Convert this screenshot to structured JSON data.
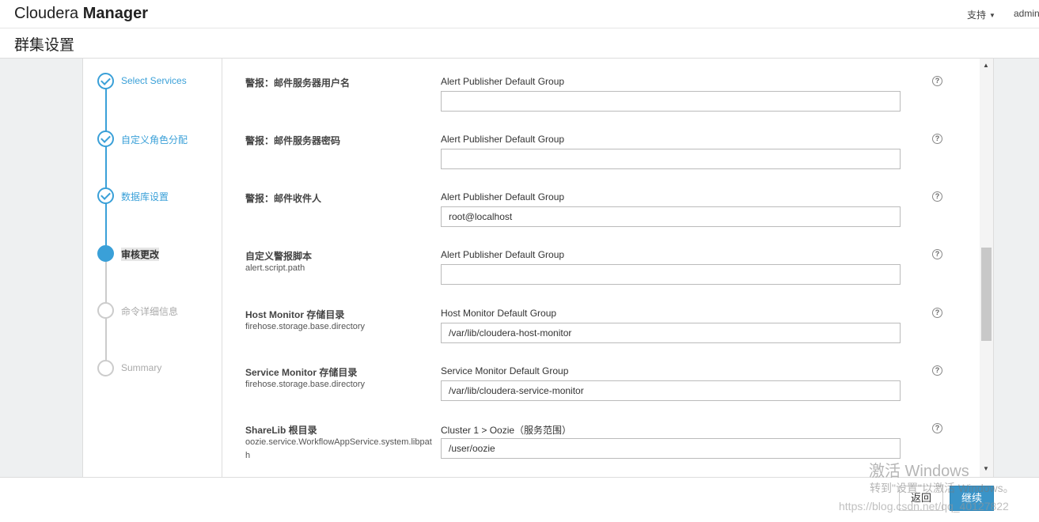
{
  "header": {
    "brand_light": "Cloudera",
    "brand_bold": "Manager",
    "support": "支持",
    "user": "admin"
  },
  "page": {
    "title": "群集设置"
  },
  "steps": [
    {
      "label": "Select Services",
      "state": "done"
    },
    {
      "label": "自定义角色分配",
      "state": "done"
    },
    {
      "label": "数据库设置",
      "state": "done"
    },
    {
      "label": "审核更改",
      "state": "active"
    },
    {
      "label": "命令详细信息",
      "state": "todo"
    },
    {
      "label": "Summary",
      "state": "todo"
    }
  ],
  "rows": [
    {
      "name": "警报：邮件服务器用户名",
      "key": "",
      "group": "Alert Publisher Default Group",
      "value": ""
    },
    {
      "name": "警报：邮件服务器密码",
      "key": "",
      "group": "Alert Publisher Default Group",
      "value": ""
    },
    {
      "name": "警报：邮件收件人",
      "key": "",
      "group": "Alert Publisher Default Group",
      "value": "root@localhost"
    },
    {
      "name": "自定义警报脚本",
      "key": "alert.script.path",
      "group": "Alert Publisher Default Group",
      "value": ""
    },
    {
      "name": "Host Monitor 存储目录",
      "key": "firehose.storage.base.directory",
      "group": "Host Monitor Default Group",
      "value": "/var/lib/cloudera-host-monitor"
    },
    {
      "name": "Service Monitor 存储目录",
      "key": "firehose.storage.base.directory",
      "group": "Service Monitor Default Group",
      "value": "/var/lib/cloudera-service-monitor"
    },
    {
      "name": "ShareLib 根目录",
      "key": "oozie.service.WorkflowAppService.system.libpath",
      "group": "Cluster 1 > Oozie（服务范围）",
      "value": "/user/oozie"
    }
  ],
  "help_glyph": "?",
  "footer": {
    "back": "返回",
    "next": "继续"
  },
  "watermark": {
    "line1": "激活 Windows",
    "line2": "转到\"设置\"以激活 Windows。",
    "url": "https://blog.csdn.net/qq_40127822"
  }
}
